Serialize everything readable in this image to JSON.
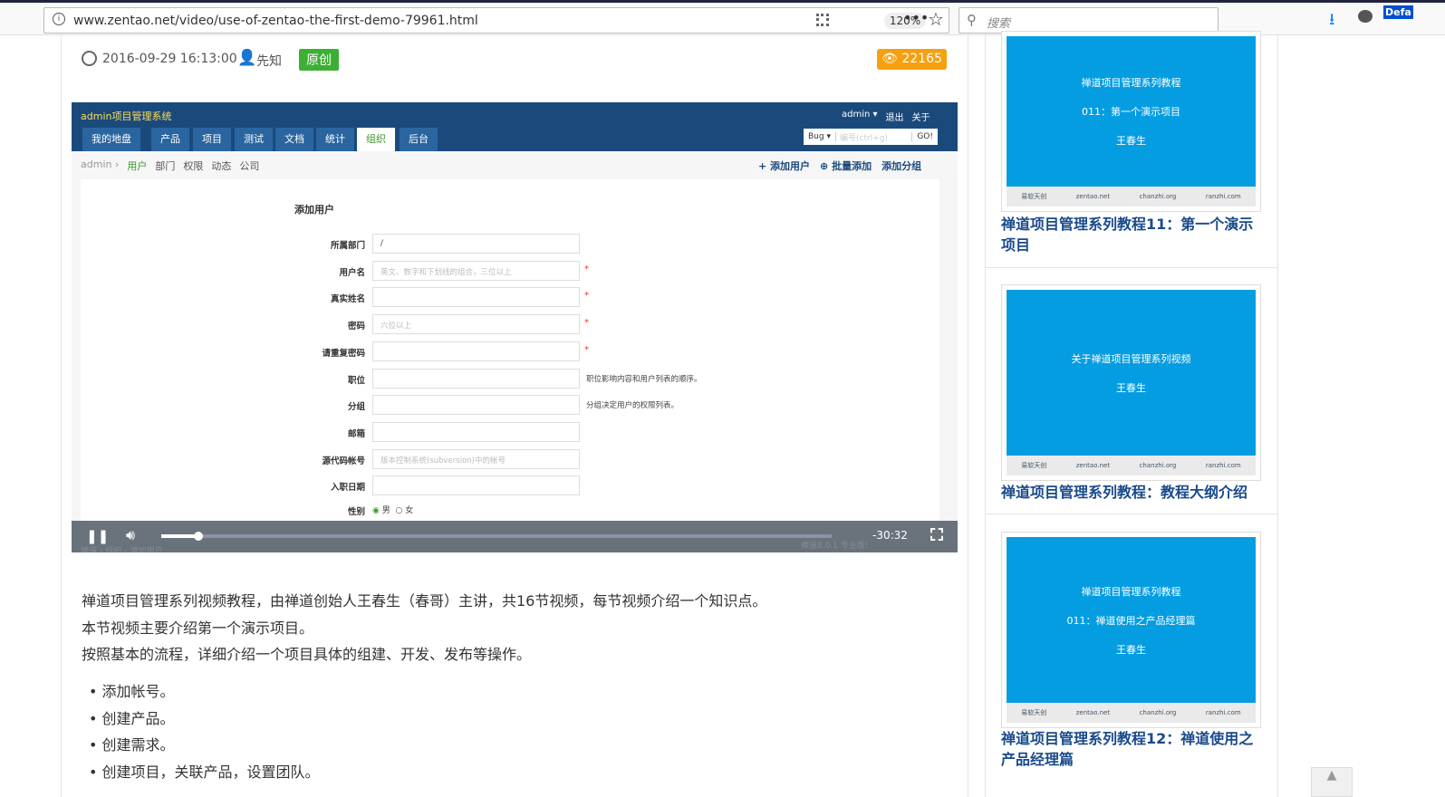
{
  "browser": {
    "url": "www.zentao.net/video/use-of-zentao-the-first-demo-79961.html",
    "zoom": "120%",
    "search_placeholder": "搜索",
    "profile_badge": "Defa"
  },
  "meta": {
    "date": "2016-09-29 16:13:00",
    "author": "先知",
    "badge": "原创",
    "views": "22165"
  },
  "video": {
    "app_title": "admin项目管理系统",
    "user_menu": [
      "admin ▾",
      "退出",
      "关于"
    ],
    "tabs": [
      "我的地盘",
      "产品",
      "项目",
      "测试",
      "文档",
      "统计",
      "组织",
      "后台"
    ],
    "search": {
      "type": "Bug ▾",
      "placeholder": "编号(ctrl+g)",
      "go": "GO!"
    },
    "crumbs": [
      "admin ›",
      "用户",
      "部门",
      "权限",
      "动态",
      "公司"
    ],
    "actions": [
      "+ 添加用户",
      "⊕ 批量添加",
      "添加分组"
    ],
    "form_title": "添加用户",
    "fields": [
      {
        "label": "所属部门",
        "value": "/",
        "placeholder": ""
      },
      {
        "label": "用户名",
        "placeholder": "英文、数字和下划线的组合，三位以上"
      },
      {
        "label": "真实姓名",
        "placeholder": ""
      },
      {
        "label": "密码",
        "placeholder": "六位以上"
      },
      {
        "label": "请重复密码",
        "placeholder": ""
      },
      {
        "label": "职位",
        "placeholder": "",
        "hint": "职位影响内容和用户列表的顺序。"
      },
      {
        "label": "分组",
        "placeholder": "",
        "hint": "分组决定用户的权限列表。"
      },
      {
        "label": "邮箱",
        "placeholder": ""
      },
      {
        "label": "源代码帐号",
        "placeholder": "版本控制系统(subversion)中的帐号"
      },
      {
        "label": "入职日期",
        "placeholder": ""
      }
    ],
    "gender": {
      "label": "性别",
      "male": "男",
      "female": "女"
    },
    "footer_crumb": "禅道 › 组织 › 添加用户",
    "footer_right": "禅道8.0.1  专业版!",
    "time_remaining": "-30:32",
    "progress": 0.055
  },
  "article": {
    "paragraphs": [
      "禅道项目管理系列视频教程，由禅道创始人王春生（春哥）主讲，共16节视频，每节视频介绍一个知识点。",
      "本节视频主要介绍第一个演示项目。",
      "按照基本的流程，详细介绍一个项目具体的组建、开发、发布等操作。"
    ],
    "bullets": [
      "添加帐号。",
      "创建产品。",
      "创建需求。",
      "创建项目，关联产品，设置团队。"
    ]
  },
  "sidebar": [
    {
      "thumb_lines": [
        "禅道项目管理系列教程",
        "011：第一个演示项目",
        "王春生"
      ],
      "title": "禅道项目管理系列教程11：第一个演示项目"
    },
    {
      "thumb_lines": [
        "关于禅道项目管理系列视频",
        "王春生"
      ],
      "title": "禅道项目管理系列教程：教程大纲介绍"
    },
    {
      "thumb_lines": [
        "禅道项目管理系列教程",
        "011：禅道使用之产品经理篇",
        "王春生"
      ],
      "title": "禅道项目管理系列教程12：禅道使用之产品经理篇"
    }
  ],
  "thumb_footer": [
    "易软天创",
    "zentao.net",
    "chanzhi.org",
    "ranzhi.com"
  ]
}
